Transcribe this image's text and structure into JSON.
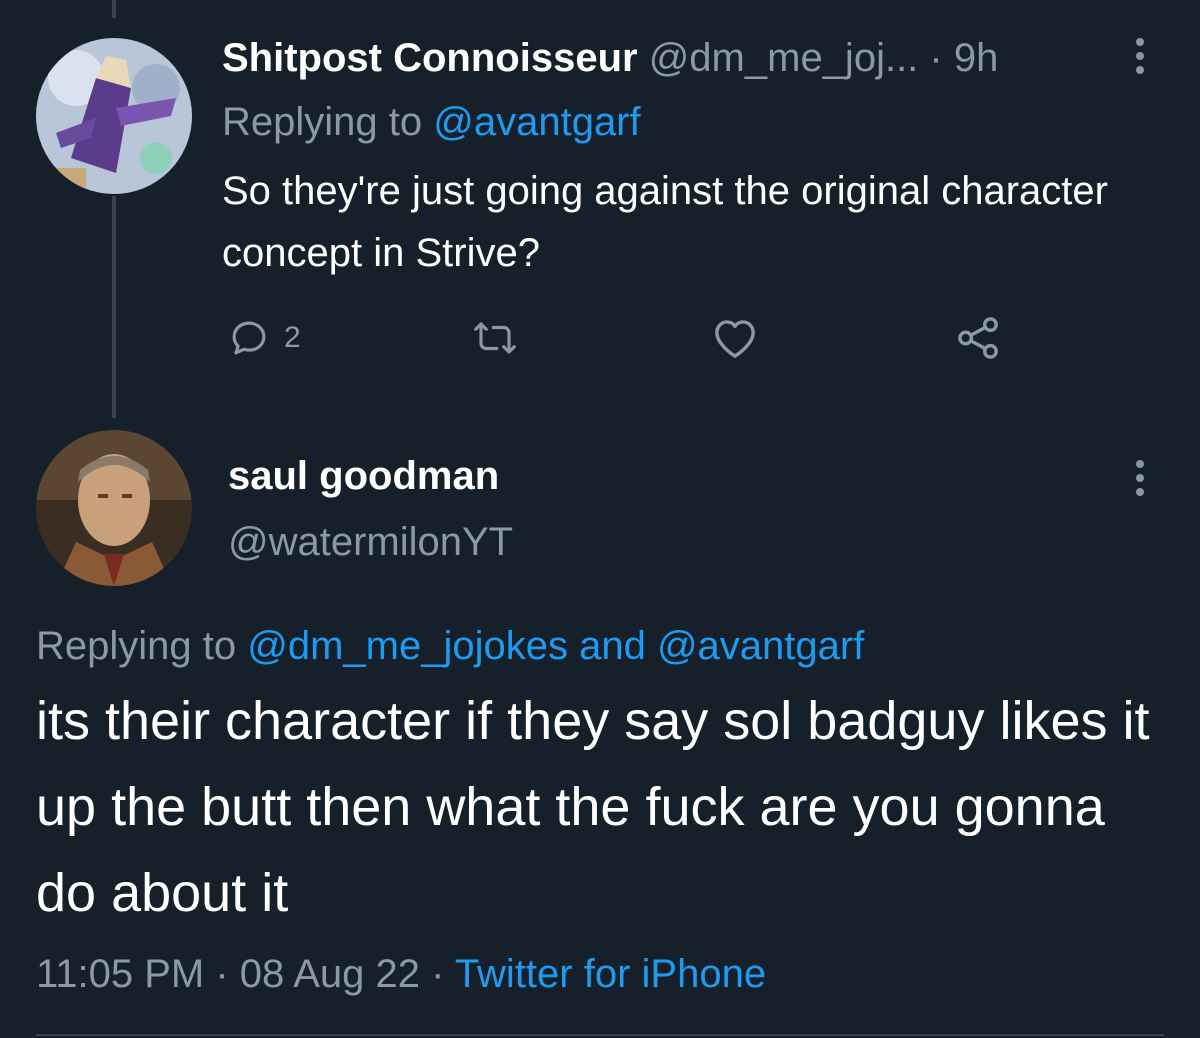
{
  "tweet1": {
    "display_name": "Shitpost Connoisseur",
    "handle": "@dm_me_joj...",
    "separator": "·",
    "time": "9h",
    "replying_prefix": "Replying to ",
    "replying_to": "@avantgarf",
    "text": "So they're just going against the original character concept in Strive?",
    "actions": {
      "reply_count": "2",
      "reply_icon": "reply-icon",
      "retweet_icon": "retweet-icon",
      "like_icon": "heart-icon",
      "share_icon": "share-icon"
    }
  },
  "tweet2": {
    "display_name": "saul goodman",
    "handle": "@watermilonYT",
    "replying_prefix": "Replying to ",
    "replying_to_1": "@dm_me_jojokes",
    "replying_and": " and ",
    "replying_to_2": "@avantgarf",
    "text": "its their character if they say sol badguy likes it up the butt then what the fuck are you gonna do about it",
    "time": "11:05 PM",
    "sep1": " · ",
    "date": "08 Aug 22",
    "sep2": " · ",
    "client": "Twitter for iPhone"
  },
  "colors": {
    "background": "#15202b",
    "text": "#ffffff",
    "muted": "#8b98a5",
    "link": "#1d9bf0",
    "divider": "#38444d"
  }
}
